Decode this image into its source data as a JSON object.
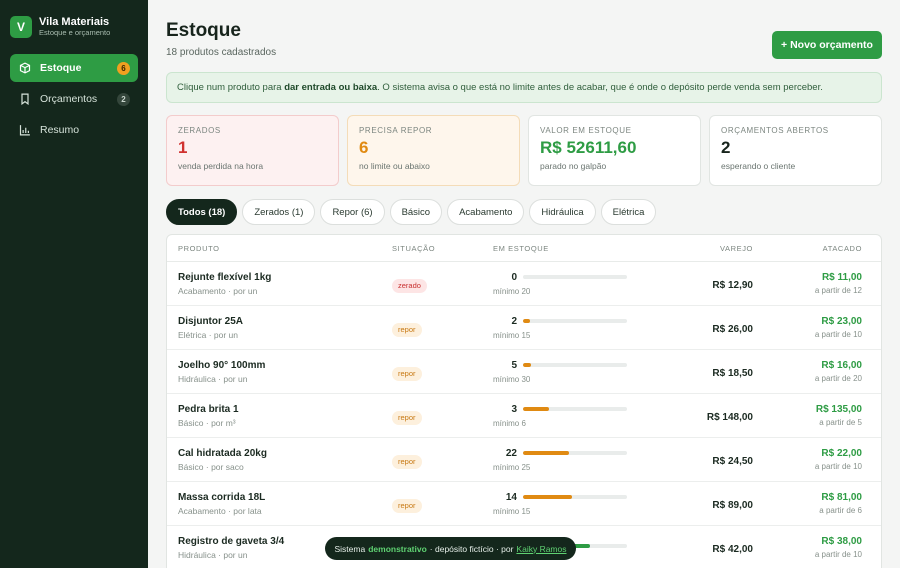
{
  "brand": {
    "logo": "V",
    "name": "Vila Materiais",
    "subtitle": "Estoque e orçamento"
  },
  "nav": [
    {
      "label": "Estoque",
      "badge": "6",
      "icon": "box-icon",
      "active": true
    },
    {
      "label": "Orçamentos",
      "badge": "2",
      "icon": "bookmark-icon",
      "active": false
    },
    {
      "label": "Resumo",
      "badge": "",
      "icon": "chart-icon",
      "active": false
    }
  ],
  "header": {
    "title": "Estoque",
    "subtitle": "18 produtos cadastrados",
    "new_button": "+ Novo orçamento"
  },
  "info": {
    "before": "Clique num produto para ",
    "bold": "dar entrada ou baixa",
    "after": ". O sistema avisa o que está no limite antes de acabar, que é onde o depósito perde venda sem perceber."
  },
  "cards": [
    {
      "label": "ZERADOS",
      "value": "1",
      "note": "venda perdida na hora",
      "color": "#d0312f"
    },
    {
      "label": "PRECISA REPOR",
      "value": "6",
      "note": "no limite ou abaixo",
      "color": "#e08a12"
    },
    {
      "label": "VALOR EM ESTOQUE",
      "value": "R$ 52611,60",
      "note": "parado no galpão",
      "color": "#2e9c44"
    },
    {
      "label": "ORÇAMENTOS ABERTOS",
      "value": "2",
      "note": "esperando o cliente",
      "color": "#17241c"
    }
  ],
  "filters": [
    "Todos (18)",
    "Zerados (1)",
    "Repor (6)",
    "Básico",
    "Acabamento",
    "Hidráulica",
    "Elétrica"
  ],
  "table": {
    "headers": {
      "product": "PRODUTO",
      "status": "SITUAÇÃO",
      "stock": "EM ESTOQUE",
      "retail": "VAREJO",
      "wholesale": "ATACADO"
    },
    "rows": [
      {
        "name": "Rejunte flexível 1kg",
        "meta": "Acabamento · por un",
        "status": "zerado",
        "qty": "0",
        "fill": 0,
        "fillColor": "#d0312f",
        "min": "mínimo 20",
        "retail": "R$ 12,90",
        "wholesale": "R$ 11,00",
        "wnote": "a partir de 12"
      },
      {
        "name": "Disjuntor 25A",
        "meta": "Elétrica · por un",
        "status": "repor",
        "qty": "2",
        "fill": 0.07,
        "fillColor": "#e08a12",
        "min": "mínimo 15",
        "retail": "R$ 26,00",
        "wholesale": "R$ 23,00",
        "wnote": "a partir de 10"
      },
      {
        "name": "Joelho 90° 100mm",
        "meta": "Hidráulica · por un",
        "status": "repor",
        "qty": "5",
        "fill": 0.08,
        "fillColor": "#e08a12",
        "min": "mínimo 30",
        "retail": "R$ 18,50",
        "wholesale": "R$ 16,00",
        "wnote": "a partir de 20"
      },
      {
        "name": "Pedra brita 1",
        "meta": "Básico · por m³",
        "status": "repor",
        "qty": "3",
        "fill": 0.25,
        "fillColor": "#e08a12",
        "min": "mínimo 6",
        "retail": "R$ 148,00",
        "wholesale": "R$ 135,00",
        "wnote": "a partir de 5"
      },
      {
        "name": "Cal hidratada 20kg",
        "meta": "Básico · por saco",
        "status": "repor",
        "qty": "22",
        "fill": 0.44,
        "fillColor": "#e08a12",
        "min": "mínimo 25",
        "retail": "R$ 24,50",
        "wholesale": "R$ 22,00",
        "wnote": "a partir de 10"
      },
      {
        "name": "Massa corrida 18L",
        "meta": "Acabamento · por lata",
        "status": "repor",
        "qty": "14",
        "fill": 0.47,
        "fillColor": "#e08a12",
        "min": "mínimo 15",
        "retail": "R$ 89,00",
        "wholesale": "R$ 81,00",
        "wnote": "a partir de 6"
      },
      {
        "name": "Registro de gaveta 3/4",
        "meta": "Hidráulica · por un",
        "status": "",
        "qty": "",
        "fill": 0.64,
        "fillColor": "#2e9c44",
        "min": "",
        "retail": "R$ 42,00",
        "wholesale": "R$ 38,00",
        "wnote": "a partir de 10"
      }
    ]
  },
  "footer": {
    "before": "Sistema",
    "highlight": "demonstrativo",
    "middle": "· depósito fictício · por",
    "link": "Kaiky Ramos"
  }
}
